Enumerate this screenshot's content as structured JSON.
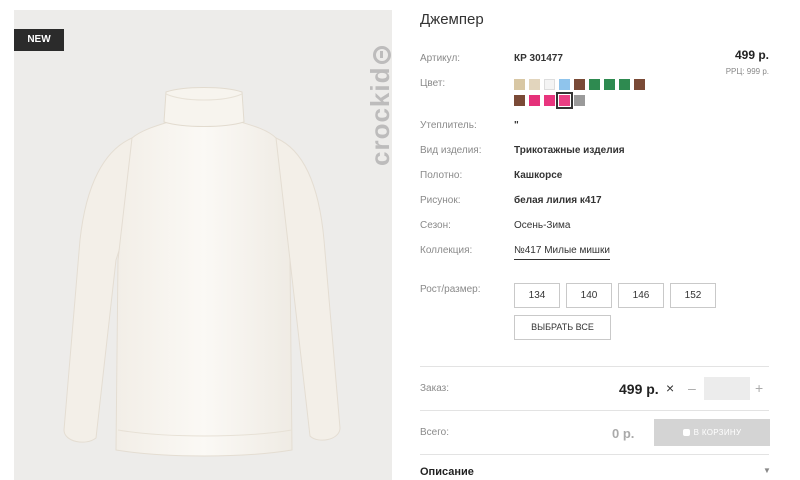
{
  "product": {
    "title": "Джемпер",
    "badge": "NEW",
    "brand": "crockid",
    "price": "499 р.",
    "rrp": "РРЦ: 999 р."
  },
  "attributes": {
    "article": {
      "label": "Артикул:",
      "value": "КР 301477"
    },
    "color_label": "Цвет:",
    "insulation": {
      "label": "Утеплитель:",
      "value": "\""
    },
    "type": {
      "label": "Вид изделия:",
      "value": "Трикотажные изделия"
    },
    "fabric": {
      "label": "Полотно:",
      "value": "Кашкорсе"
    },
    "pattern": {
      "label": "Рисунок:",
      "value": "белая лилия к417"
    },
    "season": {
      "label": "Сезон:",
      "value": "Осень-Зима"
    },
    "collection": {
      "label": "Коллекция:",
      "value": "№417 Милые мишки"
    }
  },
  "colors": {
    "row1": [
      "#d8c7a4",
      "#e2d5bd",
      "#f4f4f4",
      "#8fc4ec",
      "#7a4a36",
      "#2e8a50",
      "#2e8a50",
      "#2e8a50",
      "#7a4a36"
    ],
    "row2": [
      "#7a4a36",
      "#e5317a",
      "#e8357e",
      "#ea3f84",
      "#9a9a9a"
    ],
    "selected_row2_index": 3
  },
  "sizes": {
    "label": "Рост/размер:",
    "options": [
      "134",
      "140",
      "146",
      "152"
    ],
    "select_all": "ВЫБРАТЬ ВСЕ"
  },
  "order": {
    "label": "Заказ:",
    "price": "499 р.",
    "times": "×",
    "minus": "–",
    "plus": "+",
    "quantity": ""
  },
  "total": {
    "label": "Всего:",
    "value": "0 р.",
    "cart_button": "В КОРЗИНУ"
  },
  "description": {
    "title": "Описание"
  }
}
